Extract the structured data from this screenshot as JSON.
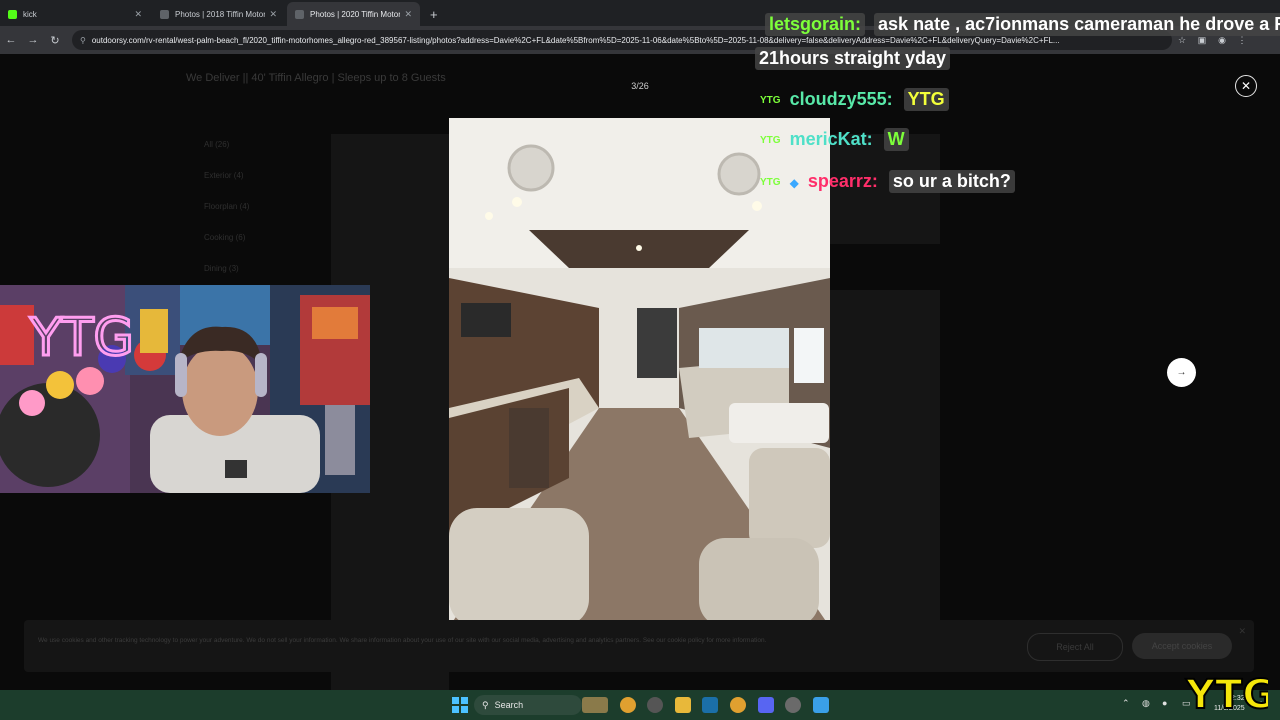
{
  "browser": {
    "tabs": [
      {
        "label": "kick",
        "active": false
      },
      {
        "label": "Photos | 2018 Tiffin Motorhomes",
        "active": false
      },
      {
        "label": "Photos | 2020 Tiffin Motorhomes",
        "active": true
      }
    ],
    "url": "outdoorsy.com/rv-rental/west-palm-beach_fl/2020_tiffin-motorhomes_allegro-red_389567-listing/photos?address=Davie%2C+FL&date%5Bfrom%5D=2025-11-06&date%5Bto%5D=2025-11-08&delivery=false&deliveryAddress=Davie%2C+FL&deliveryQuery=Davie%2C+FL..."
  },
  "page": {
    "listing_title": "We Deliver || 40' Tiffin Allegro | Sleeps up to 8 Guests",
    "side_items": [
      "All (26)",
      "Exterior (4)",
      "Floorplan (4)",
      "Cooking (6)",
      "Dining (3)"
    ],
    "counter": "3/26"
  },
  "cookie": {
    "text": "We use cookies and other tracking technology to power your adventure. We do not sell your information. We share information about your use of our site with our social media, advertising and analytics partners. See our cookie policy for more information.",
    "reject_label": "Reject All",
    "accept_label": "Accept cookies"
  },
  "chat": [
    {
      "user": "letsgorain:",
      "message": "ask nate , ac7ionmans cameraman he drove a R",
      "message2": "21hours straight yday",
      "user_color": "#7dff3a"
    },
    {
      "user": "cloudzy555:",
      "message": "YTG",
      "user_color": "#58e8a8"
    },
    {
      "user": "mericKat:",
      "message": "W",
      "user_color": "#4fe0c8"
    },
    {
      "user": "spearrz:",
      "message": "so ur a bitch?",
      "user_color": "#ff2e6a"
    }
  ],
  "chat_badge": "YTG",
  "taskbar": {
    "search_placeholder": "Search",
    "clock_time": "12:32",
    "clock_date": "11/6/2025"
  },
  "overlay": {
    "logo_text": "YTG",
    "neon_sign": "YTG"
  }
}
